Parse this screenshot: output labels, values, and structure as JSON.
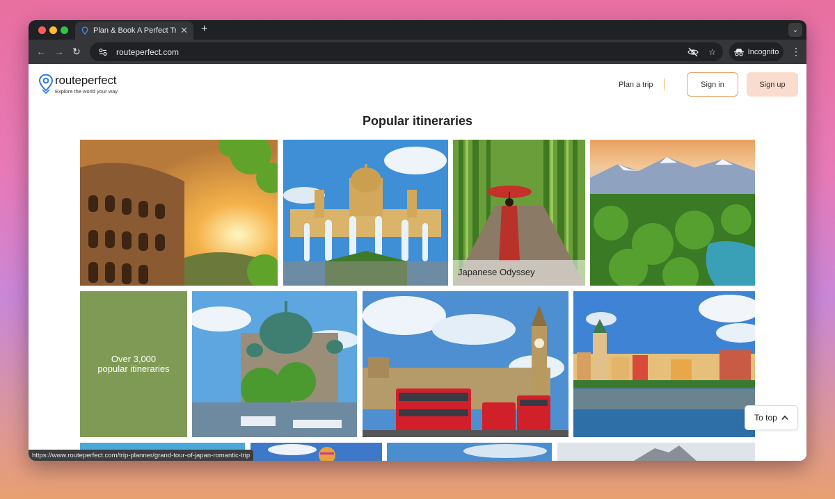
{
  "browser": {
    "tab_title": "Plan & Book A Perfect Trip W",
    "tab_close": "✕",
    "new_tab": "+",
    "url": "routeperfect.com",
    "incognito_label": "Incognito",
    "status_url": "https://www.routeperfect.com/trip-planner/grand-tour-of-japan-romantic-trip"
  },
  "site": {
    "logo_name": "routeperfect",
    "logo_tagline": "Explore the world your way",
    "nav": {
      "plan_trip": "Plan a trip",
      "sign_in": "Sign in",
      "sign_up": "Sign up"
    },
    "section_title": "Popular itineraries",
    "tiles": [
      {
        "name": "colosseum-rome-tile",
        "caption": ""
      },
      {
        "name": "barcelona-palace-tile",
        "caption": ""
      },
      {
        "name": "japanese-odyssey-tile",
        "caption": "Japanese Odyssey"
      },
      {
        "name": "new-zealand-landscape-tile",
        "caption": ""
      },
      {
        "name": "berlin-cathedral-tile",
        "caption": ""
      },
      {
        "name": "london-westminster-tile",
        "caption": ""
      },
      {
        "name": "prague-riverside-tile",
        "caption": ""
      }
    ],
    "stat_line1": "Over 3,000",
    "stat_line2": "popular itineraries",
    "to_top": "To top"
  },
  "colors": {
    "brand_blue": "#2b78e4",
    "accent_orange": "#e6a060",
    "signup_bg": "#f9dccd",
    "stat_green": "#7f9a55"
  }
}
